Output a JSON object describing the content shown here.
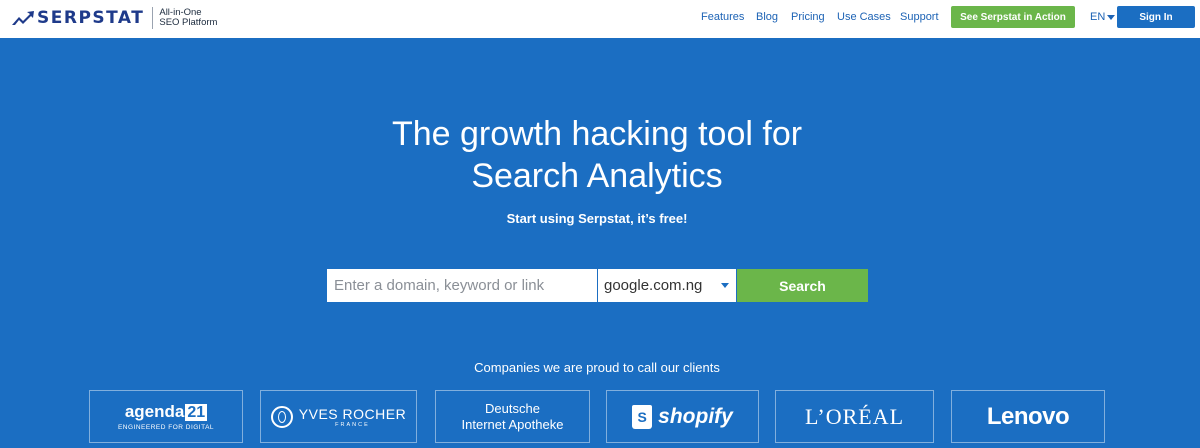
{
  "header": {
    "brand": "SERPSTAT",
    "tagline_line1": "All-in-One",
    "tagline_line2": "SEO Platform",
    "nav": {
      "features": "Features",
      "blog": "Blog",
      "pricing": "Pricing",
      "use_cases": "Use Cases",
      "support": "Support"
    },
    "cta_label": "See Serpstat in Action",
    "language": "EN",
    "signin_label": "Sign In"
  },
  "hero": {
    "title_line1": "The growth hacking tool for",
    "title_line2": "Search Analytics",
    "subtitle": "Start using Serpstat, it’s free!"
  },
  "search": {
    "placeholder": "Enter a domain, keyword or link",
    "value": "",
    "region": "google.com.ng",
    "button_label": "Search"
  },
  "clients": {
    "title": "Companies we are proud to call our clients",
    "agenda_main": "agenda",
    "agenda_num": "21",
    "agenda_sub": "ENGINEERED FOR DIGITAL",
    "yves_main": "YVES ROCHER",
    "yves_sub": "FRANCE",
    "da_line1": "Deutsche",
    "da_line2": "Internet Apotheke",
    "shopify": "shopify",
    "loreal": "L’ORÉAL",
    "lenovo": "Lenovo"
  },
  "colors": {
    "primary_blue": "#1b6ec2",
    "green": "#6bb64a",
    "brand_navy": "#1e3a8a"
  }
}
